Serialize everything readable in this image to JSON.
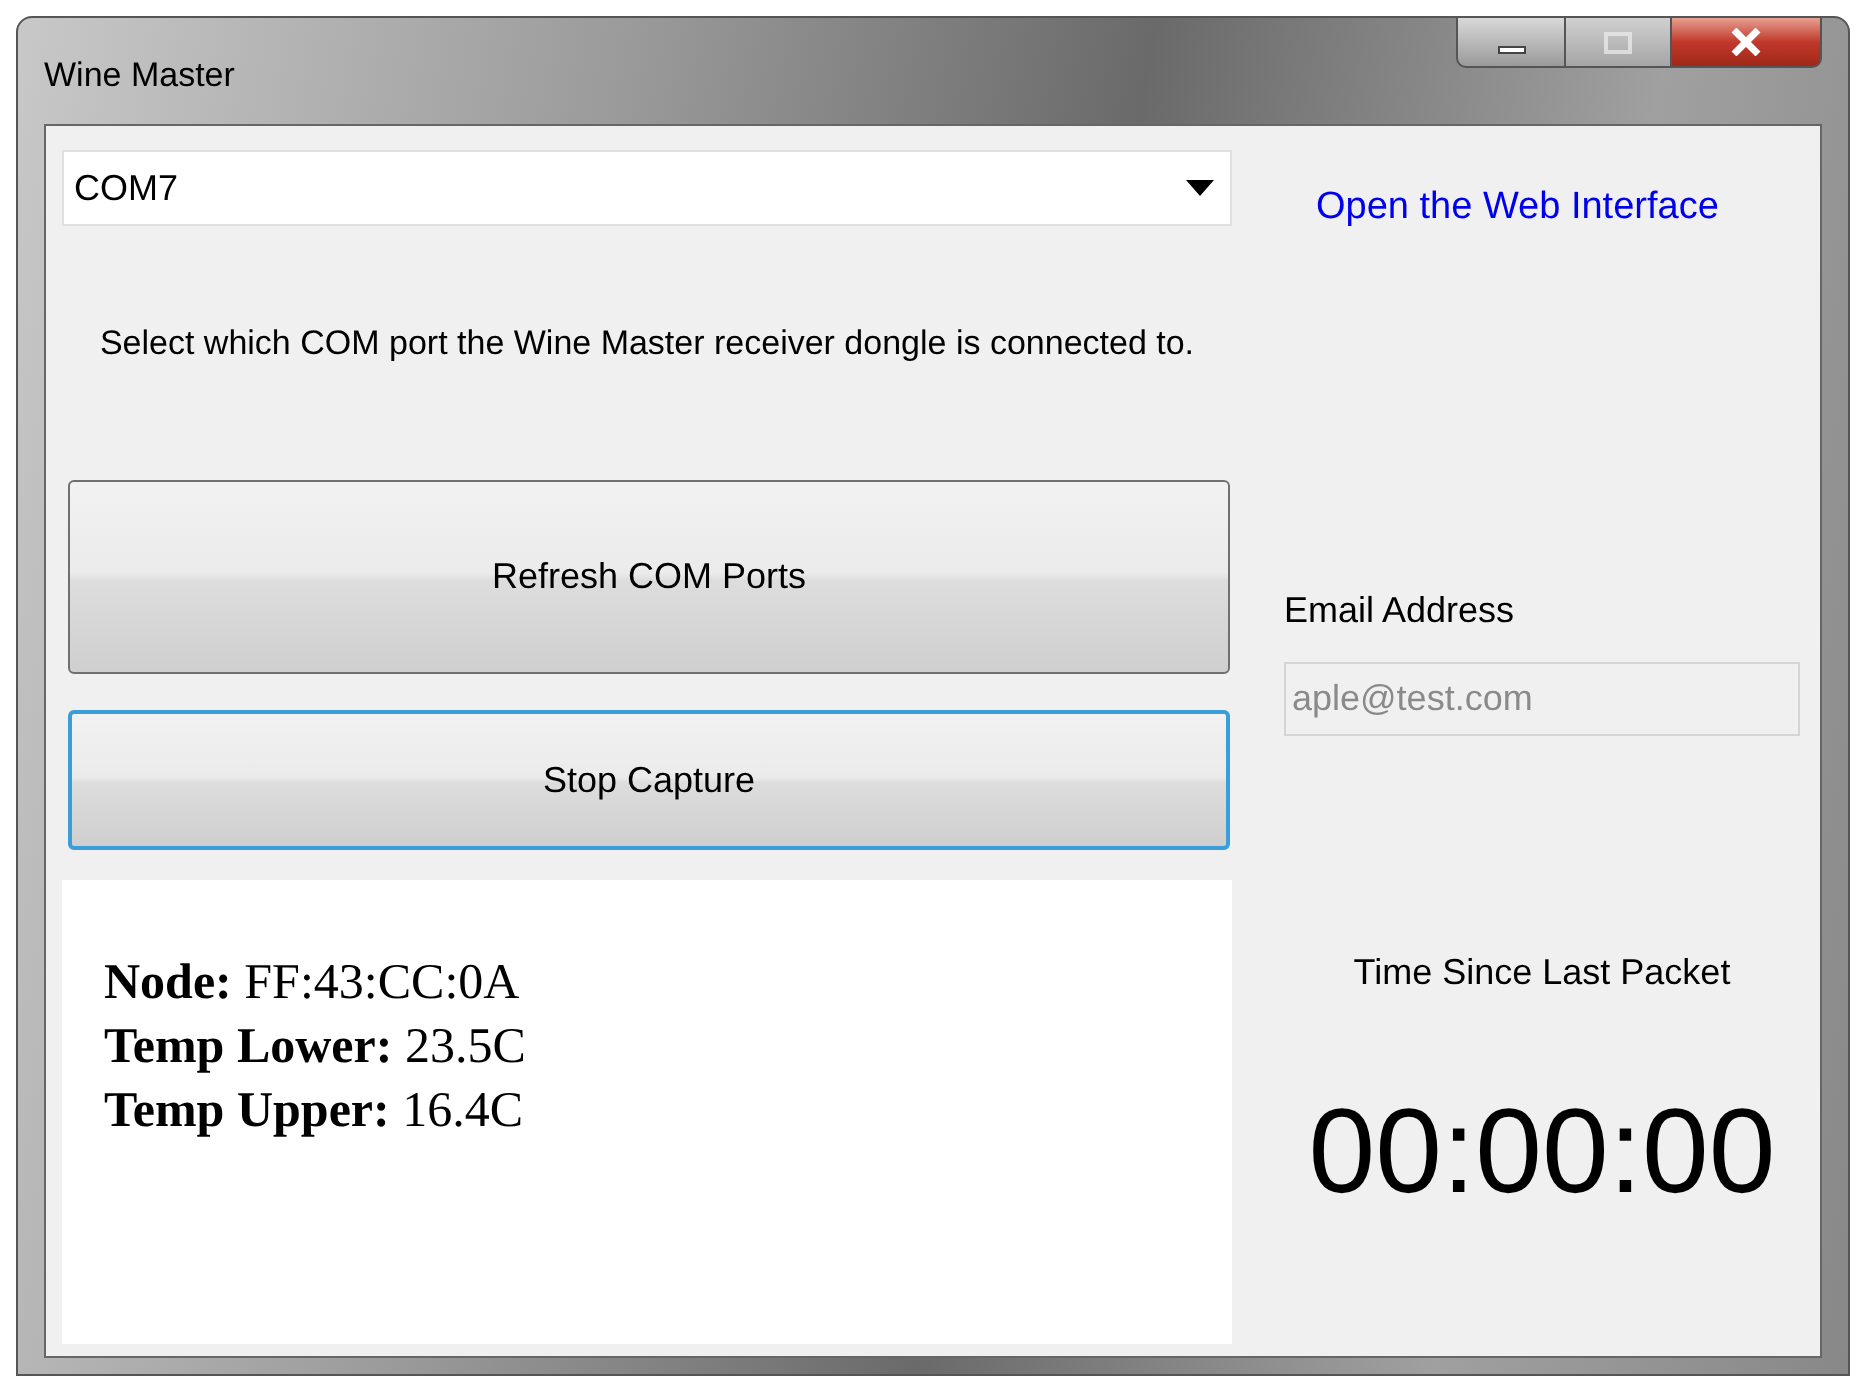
{
  "window": {
    "title": "Wine Master"
  },
  "port_select": {
    "value": "COM7"
  },
  "web_link": "Open the Web Interface",
  "help_text": "Select which COM port the Wine Master receiver dongle is connected to.",
  "buttons": [
    {
      "label": "Refresh COM Ports",
      "focused": false
    },
    {
      "label": "Stop Capture",
      "focused": true
    }
  ],
  "readings": [
    "**Node:** FF:43:CC:0A",
    "**Temp Lower:** 23.5C",
    "**Temp Upper:** 16.4C"
  ],
  "email": {
    "label": "Email Address",
    "value": "aple@test.com",
    "disabled": true
  },
  "timer": {
    "label": "Time Since Last Packet",
    "value": "00:00:00"
  }
}
